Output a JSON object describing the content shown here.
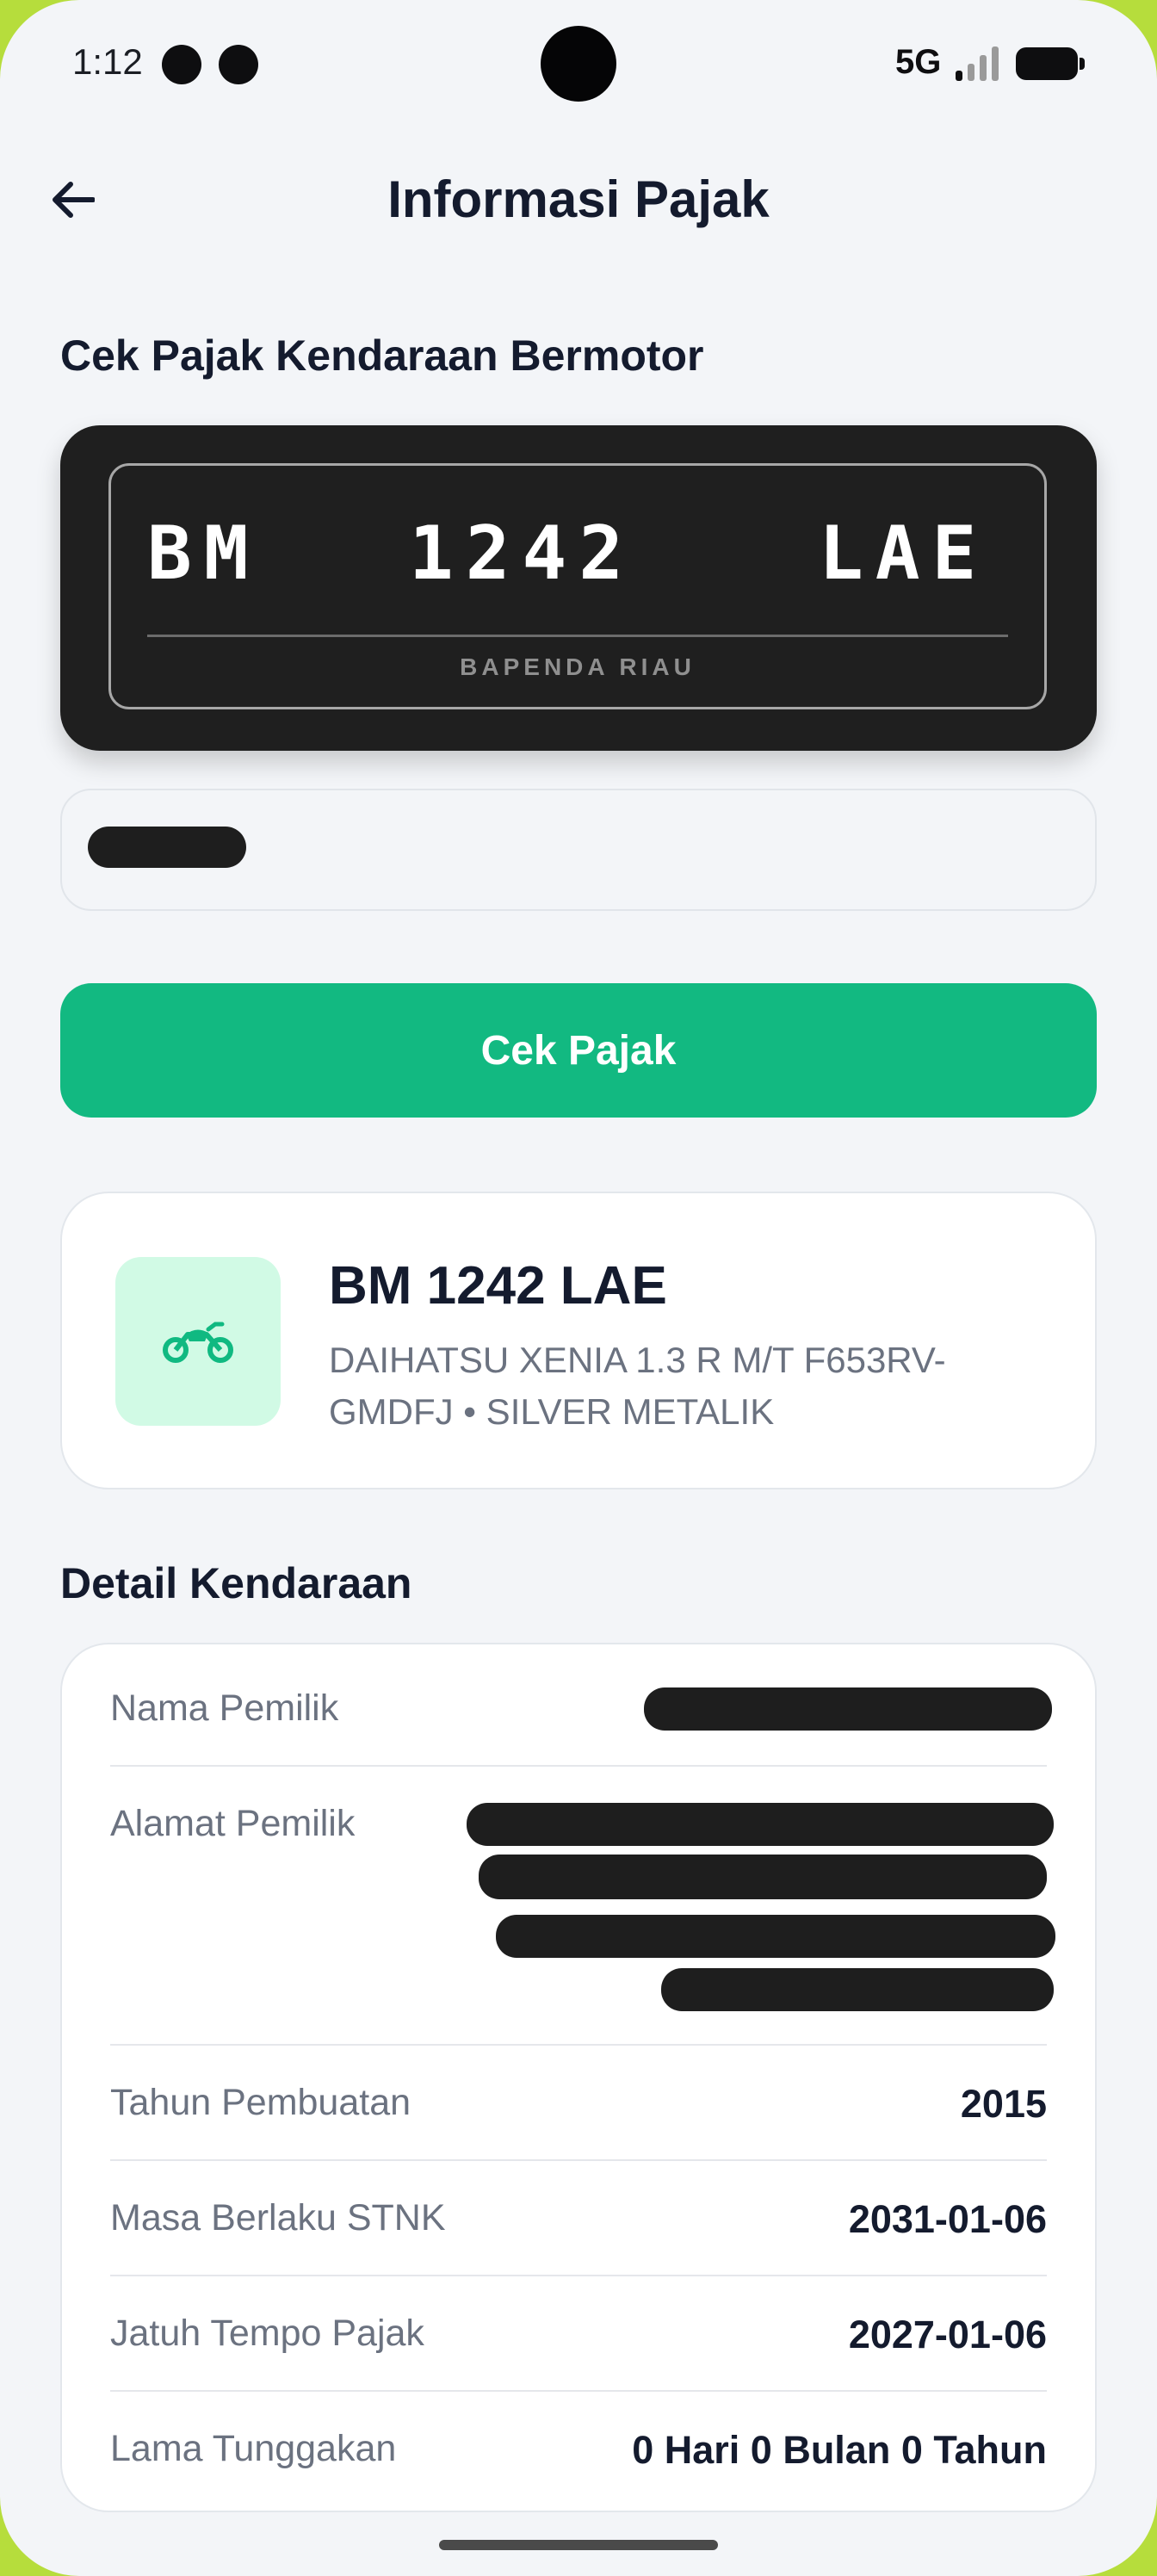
{
  "status_bar": {
    "time": "1:12",
    "network": "5G",
    "icons": [
      "notification-dot",
      "notification-dot",
      "camera-cutout",
      "signal-icon",
      "battery-icon"
    ]
  },
  "header": {
    "title": "Informasi Pajak",
    "back_icon": "arrow-left-icon"
  },
  "form": {
    "section_title": "Cek Pajak Kendaraan Bermotor",
    "plate": {
      "region": "BM",
      "number": "1242",
      "suffix": "LAE",
      "caption": "BAPENDA RIAU"
    },
    "owner_input_value": "[redacted]",
    "submit_label": "Cek Pajak"
  },
  "vehicle": {
    "icon": "motorcycle-icon",
    "plate": "BM 1242 LAE",
    "description": "DAIHATSU XENIA 1.3 R M/T F653RV-GMDFJ • SILVER METALIK"
  },
  "detail": {
    "section_title": "Detail Kendaraan",
    "rows": [
      {
        "label": "Nama Pemilik",
        "value": "[redacted]"
      },
      {
        "label": "Alamat Pemilik",
        "value": "[redacted]"
      },
      {
        "label": "Tahun Pembuatan",
        "value": "2015"
      },
      {
        "label": "Masa Berlaku STNK",
        "value": "2031-01-06"
      },
      {
        "label": "Jatuh Tempo Pajak",
        "value": "2027-01-06"
      },
      {
        "label": "Lama Tunggakan",
        "value": "0 Hari 0 Bulan 0 Tahun"
      }
    ]
  },
  "colors": {
    "primary": "#12b981",
    "icon_bg": "#d1fae5",
    "plate_bg": "#1f1f1f",
    "text_dark": "#141b2e",
    "text_muted": "#6b7280"
  }
}
